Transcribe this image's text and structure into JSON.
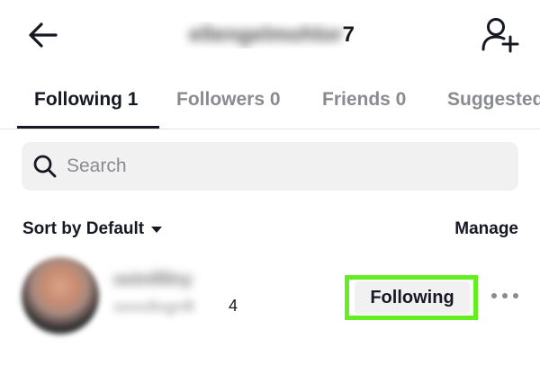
{
  "header": {
    "username": "ellengelmohlor",
    "username_end": "7",
    "back_icon": "arrow-left-icon",
    "add_user_icon": "add-user-icon"
  },
  "tabs": [
    {
      "label": "Following 1",
      "active": true
    },
    {
      "label": "Followers 0",
      "active": false
    },
    {
      "label": "Friends 0",
      "active": false
    },
    {
      "label": "Suggested",
      "active": false
    }
  ],
  "search": {
    "placeholder": "Search",
    "value": ""
  },
  "sortbar": {
    "sort_label": "Sort by Default",
    "manage_label": "Manage"
  },
  "users": [
    {
      "display_name": "ooinllllny",
      "handle": "oooollognlll",
      "handle_end": "4",
      "button_label": "Following"
    }
  ],
  "colors": {
    "highlight": "#62ee1f",
    "text": "#161823",
    "muted": "#8a8b91",
    "field_bg": "#f1f1f2"
  }
}
